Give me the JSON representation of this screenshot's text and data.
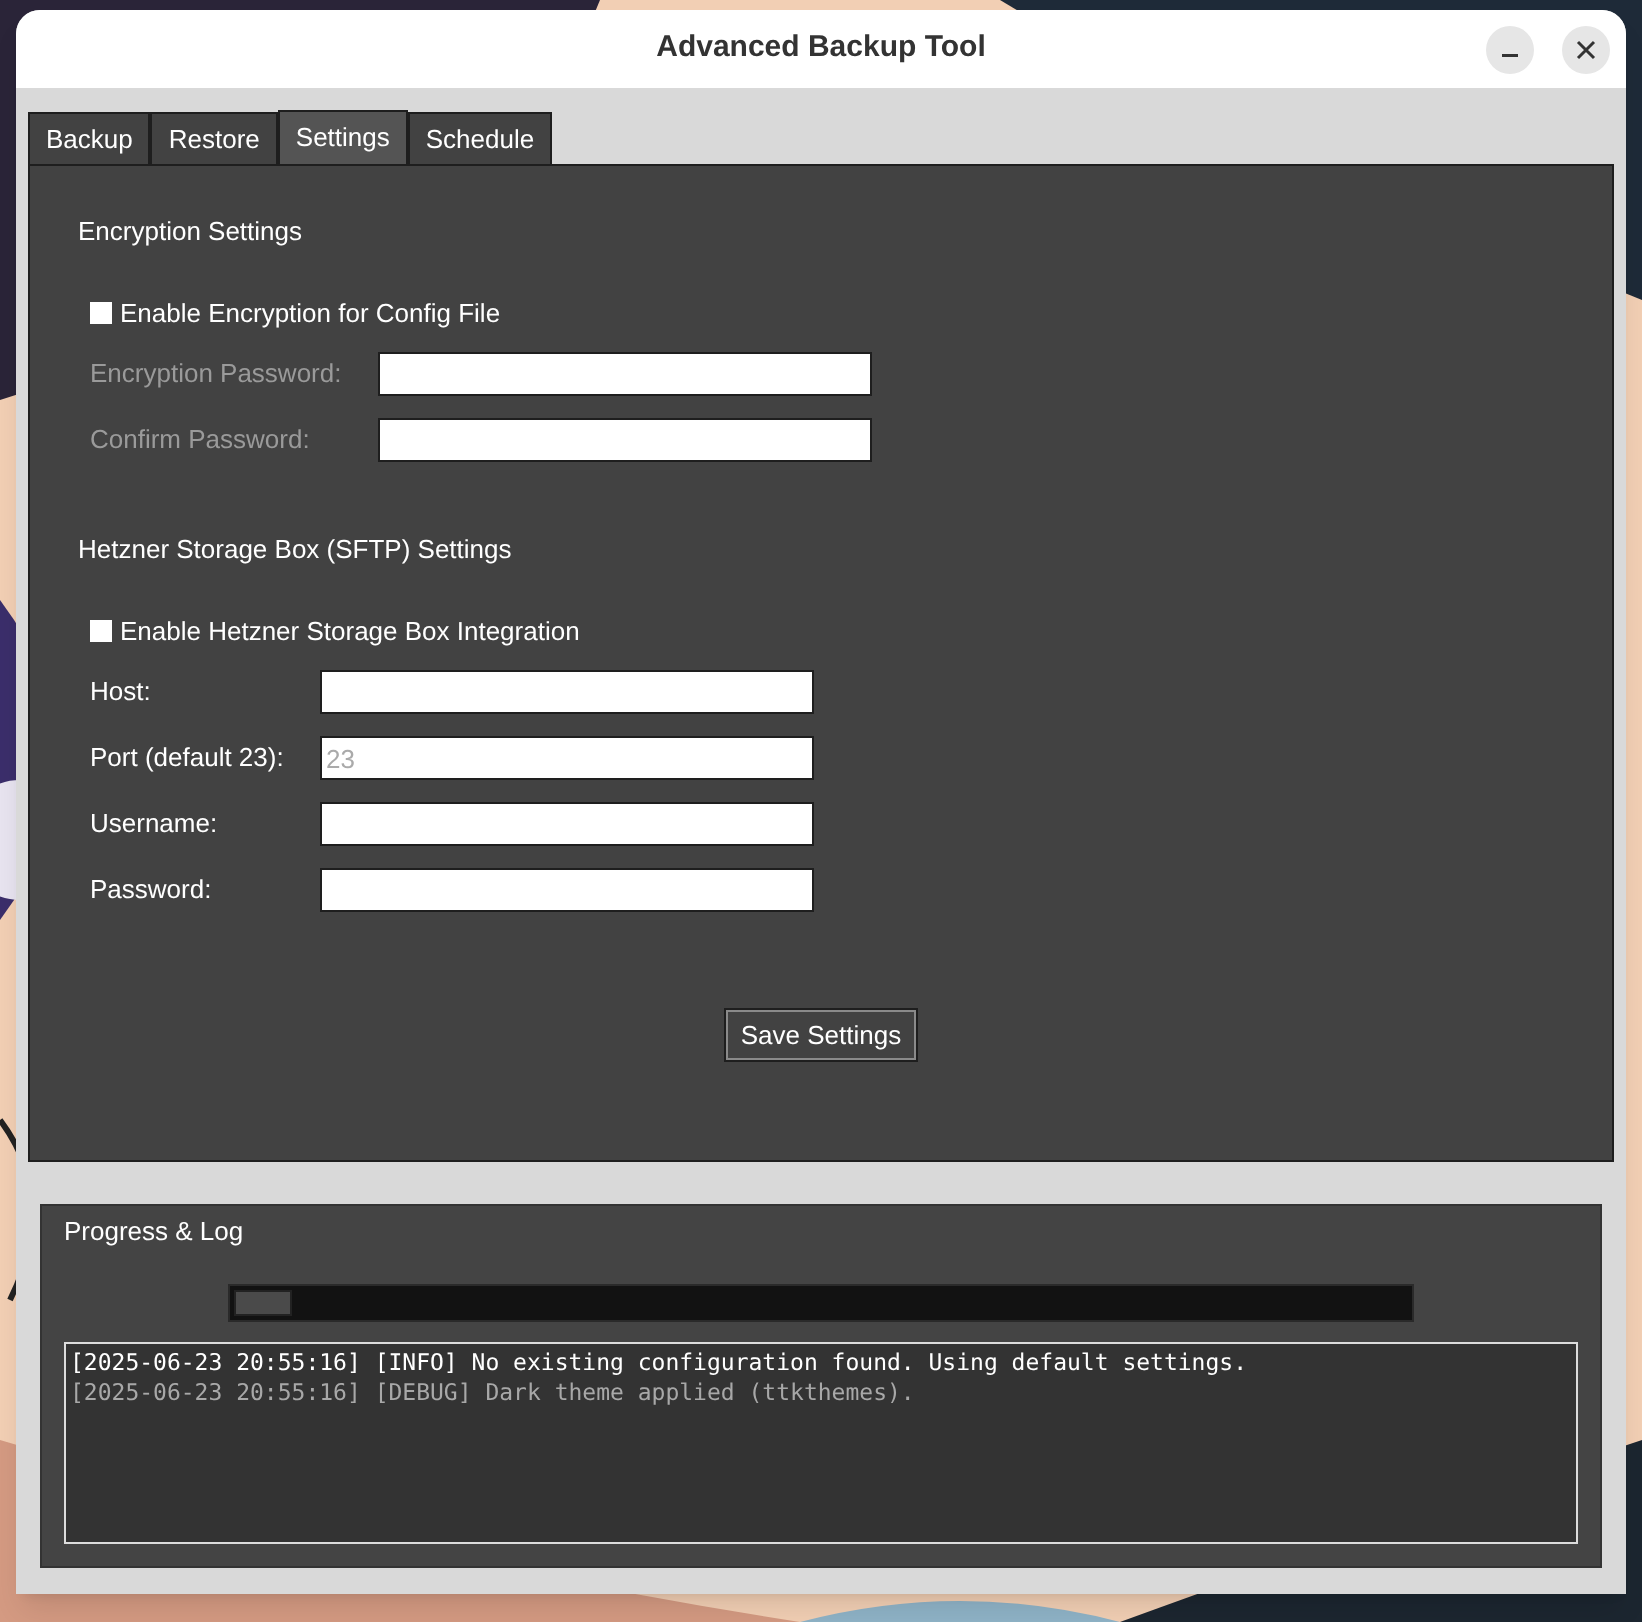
{
  "window": {
    "title": "Advanced Backup Tool"
  },
  "tabs": [
    {
      "label": "Backup",
      "selected": false
    },
    {
      "label": "Restore",
      "selected": false
    },
    {
      "label": "Settings",
      "selected": true
    },
    {
      "label": "Schedule",
      "selected": false
    }
  ],
  "sections": [
    {
      "title": "Encryption Settings",
      "checkbox": {
        "label": "Enable Encryption for Config File",
        "checked": false
      },
      "fields": [
        {
          "label": "Encryption Password:",
          "disabled": true
        },
        {
          "label": "Confirm Password:",
          "disabled": true
        }
      ]
    },
    {
      "title": "Hetzner Storage Box (SFTP) Settings",
      "checkbox": {
        "label": "Enable Hetzner Storage Box Integration",
        "checked": false
      },
      "fields": [
        {
          "label": "Host:",
          "disabled": false
        },
        {
          "label": "Port (default 23):",
          "disabled": false,
          "placeholder": "23"
        },
        {
          "label": "Username:",
          "disabled": false
        },
        {
          "label": "Password:",
          "disabled": false
        }
      ]
    }
  ],
  "save_button": "Save Settings",
  "progress_log": {
    "title": "Progress & Log",
    "progress": {
      "level": 0.05
    },
    "log": [
      {
        "kind": "info",
        "text": "[2025-06-23 20:55:16] [INFO] No existing configuration found. Using default settings."
      },
      {
        "kind": "debug",
        "text": "[2025-06-23 20:55:16] [DEBUG] Dark theme applied (ttkthemes)."
      }
    ]
  }
}
